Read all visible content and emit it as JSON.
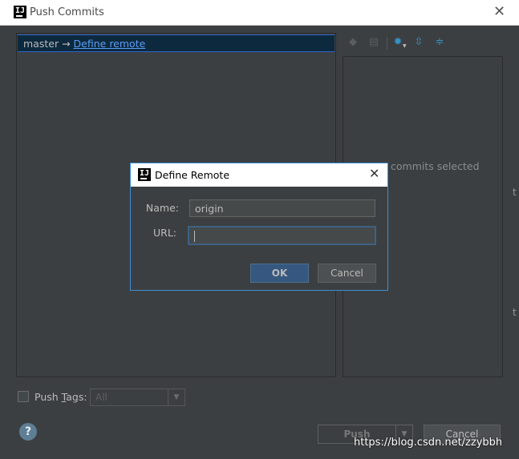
{
  "window": {
    "title": "Push Commits",
    "app_icon": "intellij-icon",
    "close_glyph": "✕"
  },
  "branch": {
    "local": "master",
    "arrow": "→",
    "remote_link": "Define remote"
  },
  "toolbar": {
    "icons": [
      "pin-icon",
      "doc-icon",
      "gear-icon",
      "expand-all-icon",
      "collapse-all-icon"
    ]
  },
  "details": {
    "empty_text": "commits selected"
  },
  "push_tags": {
    "label_prefix": "Push ",
    "label_mnemonic": "T",
    "label_suffix": "ags:",
    "select_value": "All",
    "checked": false
  },
  "buttons": {
    "help": "?",
    "push": "Push",
    "cancel": "Cancel"
  },
  "watermark": "https://blog.csdn.net/zzybbh",
  "dialog": {
    "title": "Define Remote",
    "name_label": "Name:",
    "name_value": "origin",
    "url_label": "URL:",
    "url_value": "",
    "ok_label": "OK",
    "cancel_label": "Cancel"
  },
  "colors": {
    "background": "#3c3f41",
    "selection": "#0d293e",
    "link": "#589df6",
    "default_button": "#365880",
    "focus_border": "#3d8fd6"
  }
}
